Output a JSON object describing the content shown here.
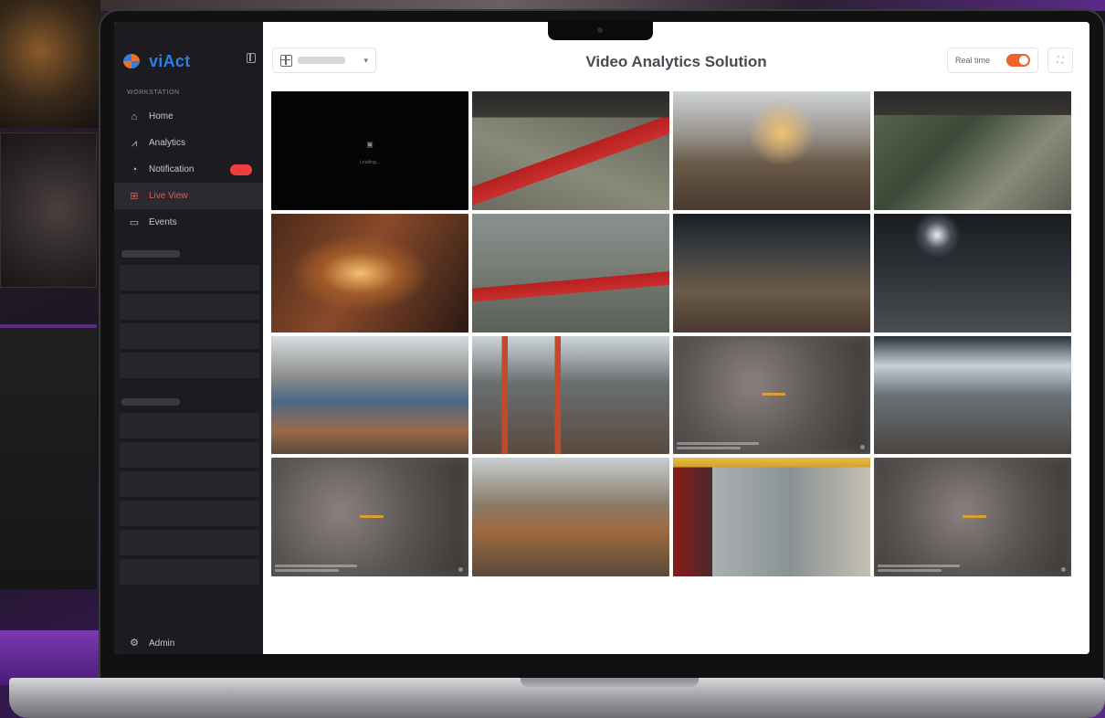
{
  "app": {
    "brand": "viAct",
    "title": "Video Analytics Solution"
  },
  "sidebar": {
    "section_label": "Workstation",
    "items": [
      {
        "label": "Home",
        "icon": "home-icon",
        "active": false
      },
      {
        "label": "Analytics",
        "icon": "analytics-icon",
        "active": false
      },
      {
        "label": "Notification",
        "icon": "bell-icon",
        "active": false,
        "badge": true
      },
      {
        "label": "Live View",
        "icon": "grid-icon",
        "active": true
      },
      {
        "label": "Events",
        "icon": "monitor-icon",
        "active": false
      }
    ],
    "footer_label": "Admin"
  },
  "toolbar": {
    "realtime_label": "Real time",
    "realtime_on": true
  },
  "cameras": {
    "no_signal_text": "Loading...",
    "tiles": [
      {
        "kind": "no-signal"
      },
      {
        "kind": "feed",
        "scene": "factory-red-rails"
      },
      {
        "kind": "feed",
        "scene": "workshop-bright"
      },
      {
        "kind": "feed",
        "scene": "factory-green-machines"
      },
      {
        "kind": "feed",
        "scene": "steel-truss-lights"
      },
      {
        "kind": "feed",
        "scene": "factory-red-rails-2"
      },
      {
        "kind": "feed",
        "scene": "warehouse-pillars"
      },
      {
        "kind": "feed",
        "scene": "dark-hall"
      },
      {
        "kind": "feed",
        "scene": "pipes-hall"
      },
      {
        "kind": "feed",
        "scene": "columns-hall"
      },
      {
        "kind": "feed-blurred",
        "scene": "offline"
      },
      {
        "kind": "feed",
        "scene": "truss-hall"
      },
      {
        "kind": "feed-blurred",
        "scene": "offline"
      },
      {
        "kind": "feed",
        "scene": "overhead-floor"
      },
      {
        "kind": "feed",
        "scene": "crane-bay"
      },
      {
        "kind": "feed-blurred",
        "scene": "offline"
      }
    ]
  },
  "colors": {
    "accent": "#f0632a",
    "brand": "#2f7fe0",
    "alert": "#f03e3e"
  }
}
